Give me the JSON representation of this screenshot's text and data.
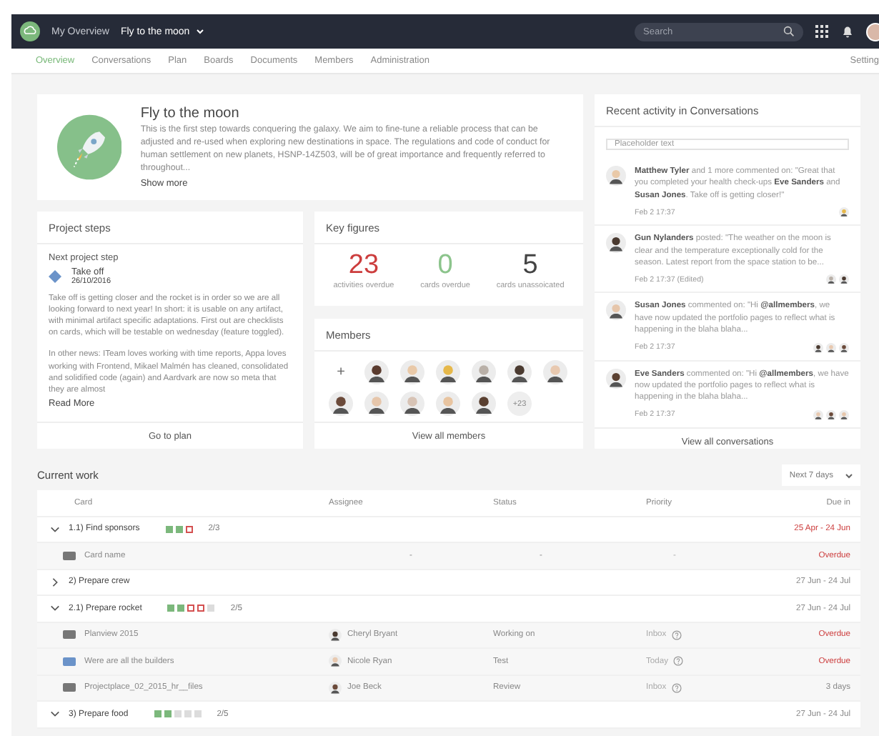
{
  "topbar": {
    "home": "My Overview",
    "project": "Fly to the moon",
    "search": {
      "placeholder": "Search"
    }
  },
  "tabs": [
    {
      "label": "Overview",
      "selected": true
    },
    {
      "label": "Conversations",
      "selected": false
    },
    {
      "label": "Plan",
      "selected": false
    },
    {
      "label": "Boards",
      "selected": false
    },
    {
      "label": "Documents",
      "selected": false
    },
    {
      "label": "Members",
      "selected": false
    },
    {
      "label": "Administration",
      "selected": false
    }
  ],
  "settings": "Setting",
  "hero": {
    "title": "Fly to the moon",
    "text": "This is the first step towards conquering the galaxy. We aim to fine-tune a reliable process that can be adjusted and re-used when exploring new destinations in space. The regulations and code of conduct for human settlement on new planets, HSNP-14Z503, will be of great importance and frequently referred to throughout...",
    "more": "Show more"
  },
  "project_steps": {
    "title": "Project steps",
    "subtitle": "Next project step",
    "step": "Take off",
    "date": "26/10/2016",
    "paragraphs": [
      "Take off is getting closer and the rocket is in order so we are all looking forward to next year! In short: it is usable on any artifact, with minimal artifact specific adaptations. First out are checklists on cards, which will be testable on wednesday (feature toggled).",
      "In other news: ITeam loves working with time reports, Appa loves working with Frontend, Mikael Malmén has cleaned, consolidated and solidified code (again) and Aardvark are now so meta that they are almost"
    ],
    "read_more": "Read More",
    "footer": "Go to plan"
  },
  "key_figures": {
    "title": "Key figures",
    "items": [
      {
        "value": "23",
        "label": "activities overdue",
        "color": "#cc3d3d"
      },
      {
        "value": "0",
        "label": "cards overdue",
        "color": "#8cc48c"
      },
      {
        "value": "5",
        "label": "cards unassoicated",
        "color": "#444444"
      }
    ]
  },
  "members": {
    "title": "Members",
    "add": "+",
    "more": "+23",
    "footer": "View all members"
  },
  "activity": {
    "title": "Recent activity in Conversations",
    "placeholder": "Placeholder text",
    "items": [
      {
        "text": "**Matthew Tyler** and 1 more commented on: \"Great that you completed your health check-ups **Eve Sanders** and **Susan Jones**. Take off is getting closer!\"",
        "time": "Feb 2 17:37"
      },
      {
        "text": "**Gun Nylanders** posted: \"The weather on the moon is clear and the temperature exceptionally cold for the season. Latest report from the space station to be...",
        "time": "Feb 2 17:37 (Edited)"
      },
      {
        "text": "**Susan Jones** commented on: \"Hi **@allmembers**, we have now updated the portfolio pages to reflect what is happening in the blaha blaha...",
        "time": "Feb 2 17:37"
      },
      {
        "text": "**Eve Sanders** commented on: \"Hi **@allmembers**, we have now updated the portfolio pages to reflect what is happening in the blaha blaha...",
        "time": "Feb 2 17:37"
      }
    ],
    "footer": "View all conversations"
  },
  "current_work": {
    "title": "Current work",
    "range": "Next 7 days",
    "columns": [
      "Card",
      "Assignee",
      "Status",
      "Priority",
      "Due in"
    ],
    "rows": [
      {
        "kind": "group",
        "expanded": true,
        "name": "1.1) Find sponsors",
        "progress": [
          {
            "kind": "done"
          },
          {
            "kind": "done"
          },
          {
            "kind": "late"
          }
        ],
        "count": "2/3",
        "due": "25 Apr - 24 Jun",
        "overdue": true
      },
      {
        "kind": "card",
        "name": "Card name",
        "color": "#777777",
        "assignee": "-",
        "status": "-",
        "priority": "-",
        "due": "Overdue",
        "overdue": true
      },
      {
        "kind": "group",
        "expanded": false,
        "name": "2) Prepare crew",
        "due": "27 Jun - 24 Jul",
        "overdue": false
      },
      {
        "kind": "group",
        "expanded": true,
        "name": "2.1) Prepare rocket",
        "progress": [
          {
            "kind": "done"
          },
          {
            "kind": "done"
          },
          {
            "kind": "late"
          },
          {
            "kind": "late"
          },
          {
            "kind": "open"
          }
        ],
        "count": "2/5",
        "due": "27 Jun - 24 Jul",
        "overdue": false
      },
      {
        "kind": "card",
        "name": "Planview 2015",
        "color": "#777777",
        "assignee": "Cheryl Bryant",
        "status": "Working on",
        "priority": "Inbox",
        "due": "Overdue",
        "overdue": true
      },
      {
        "kind": "card",
        "name": "Were are all the builders",
        "color": "#6b93c9",
        "assignee": "Nicole Ryan",
        "status": "Test",
        "priority": "Today",
        "due": "Overdue",
        "overdue": true
      },
      {
        "kind": "card",
        "name": "Projectplace_02_2015_hr__files",
        "color": "#777777",
        "assignee": "Joe Beck",
        "status": "Review",
        "priority": "Inbox",
        "due": "3 days",
        "overdue": false
      },
      {
        "kind": "group",
        "expanded": true,
        "name": "3) Prepare food",
        "progress": [
          {
            "kind": "done"
          },
          {
            "kind": "done"
          },
          {
            "kind": "open"
          },
          {
            "kind": "open"
          },
          {
            "kind": "open"
          }
        ],
        "count": "2/5",
        "due": "27 Jun - 24 Jul",
        "overdue": false
      }
    ]
  }
}
